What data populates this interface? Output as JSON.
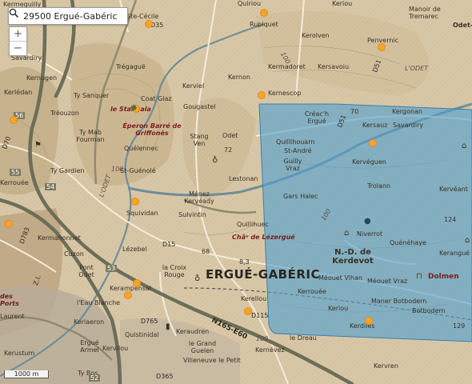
{
  "search": {
    "value": "29500 Ergué-Gabéric"
  },
  "zoom": {
    "in_label": "+",
    "out_label": "−"
  },
  "scale": {
    "label": "1000 m"
  },
  "places": [
    {
      "id": "kermeguilly",
      "text": "Kermeguilly"
    },
    {
      "id": "ste-cecile",
      "text": "Ste-Cécile"
    },
    {
      "id": "d35",
      "text": "D35"
    },
    {
      "id": "quirioux",
      "text": "Quiriou"
    },
    {
      "id": "keriou-top",
      "text": "Keriou"
    },
    {
      "id": "manoir-tremarec",
      "text": "Manoir de Tremarec"
    },
    {
      "id": "odet-top",
      "text": "Odet-"
    },
    {
      "id": "rupiquet",
      "text": "Rupiquet"
    },
    {
      "id": "kerolven",
      "text": "Kerolven"
    },
    {
      "id": "penvernic",
      "text": "Penvernic"
    },
    {
      "id": "savardiry-left",
      "text": "Savardiry"
    },
    {
      "id": "tregague",
      "text": "Trégaguë"
    },
    {
      "id": "kermadoret",
      "text": "Kermadoret"
    },
    {
      "id": "kersavoiu",
      "text": "Kersavoiu"
    },
    {
      "id": "d51-top",
      "text": "D51"
    },
    {
      "id": "lodet-top",
      "text": "L'ODET"
    },
    {
      "id": "kernugen",
      "text": "Kernugen"
    },
    {
      "id": "kerledan",
      "text": "Kerlédan"
    },
    {
      "id": "ty-sanquer",
      "text": "Ty Sanquer"
    },
    {
      "id": "kerviel",
      "text": "Kerviel"
    },
    {
      "id": "kernon",
      "text": "Kernon"
    },
    {
      "id": "kernescop",
      "text": "Kernescop"
    },
    {
      "id": "coat-glaz",
      "text": "Coat Glaz"
    },
    {
      "id": "le-stangala",
      "text": "le Stangala"
    },
    {
      "id": "gougastel",
      "text": "Gougastel"
    },
    {
      "id": "kergonan",
      "text": "Kergonan"
    },
    {
      "id": "treouzon",
      "text": "Tréouzon"
    },
    {
      "id": "creach-ergue",
      "text": "Créac'h Ergué"
    },
    {
      "id": "ty-mab-fourman",
      "text": "Ty Mab Fourman"
    },
    {
      "id": "eperon",
      "text": "Éperon Barré de Griffonès"
    },
    {
      "id": "odet-mid",
      "text": "Odet"
    },
    {
      "id": "kersauz",
      "text": "Kersauz"
    },
    {
      "id": "savardiry-right",
      "text": "Savardiry"
    },
    {
      "id": "quelennec",
      "text": "Quélennec"
    },
    {
      "id": "stang-ven",
      "text": "Stang Ven"
    },
    {
      "id": "quillihouarn",
      "text": "Quillihouarn"
    },
    {
      "id": "st-andre",
      "text": "St-André"
    },
    {
      "id": "guilly-vraz",
      "text": "Guilly Vraz"
    },
    {
      "id": "kerveguen",
      "text": "Kervéguen"
    },
    {
      "id": "ty-gardien",
      "text": "Ty Gardien"
    },
    {
      "id": "st-guenole",
      "text": "St-Guénolé"
    },
    {
      "id": "lestonan",
      "text": "Lestonan"
    },
    {
      "id": "trolann",
      "text": "Trolann"
    },
    {
      "id": "kerveant",
      "text": "Kervéant"
    },
    {
      "id": "kerrouee",
      "text": "Kerrouée"
    },
    {
      "id": "lodet-mid",
      "text": "L'ODET"
    },
    {
      "id": "menez-kerveady",
      "text": "Ménez Kervéady"
    },
    {
      "id": "gars-halec",
      "text": "Gars Halec"
    },
    {
      "id": "squividan",
      "text": "Squividan"
    },
    {
      "id": "sulvintin",
      "text": "Sulvintin"
    },
    {
      "id": "quillihuec",
      "text": "Quillihuec"
    },
    {
      "id": "kermahonnet",
      "text": "Kermahonnet"
    },
    {
      "id": "chateau-lezergue",
      "text": "Châᵘ de Lézergué"
    },
    {
      "id": "niverrot",
      "text": "Niverrot"
    },
    {
      "id": "quenehaye",
      "text": "Quénéhaye"
    },
    {
      "id": "kerangue",
      "text": "Kerangué"
    },
    {
      "id": "cuzon",
      "text": "Cuzon"
    },
    {
      "id": "lezebel",
      "text": "Lézebel"
    },
    {
      "id": "nd-kerdevot",
      "text": "N.-D. de Kerdevot"
    },
    {
      "id": "pont-odet",
      "text": "Pont Odet"
    },
    {
      "id": "la-croix-rouge",
      "text": "la Croix Rouge"
    },
    {
      "id": "ergue-gaberic",
      "text": "ERGUÉ-GABÉRIC"
    },
    {
      "id": "dolmen",
      "text": "Dolmen"
    },
    {
      "id": "meouet-vihan",
      "text": "Méouet Vihan"
    },
    {
      "id": "meouet-vraz",
      "text": "Méouet Vraz"
    },
    {
      "id": "za",
      "text": "Z.I."
    },
    {
      "id": "kerampensal",
      "text": "Kerampensal"
    },
    {
      "id": "kerrouee2",
      "text": "Kerrouée"
    },
    {
      "id": "des-ports",
      "text": "des Ports"
    },
    {
      "id": "eau-blanche",
      "text": "l'Eau Blanche"
    },
    {
      "id": "kerellou",
      "text": "Kerellou"
    },
    {
      "id": "keriou-bot",
      "text": "Keriou"
    },
    {
      "id": "maner-botbodern",
      "text": "Maner Botbodern"
    },
    {
      "id": "botbodern",
      "text": "Botbodern"
    },
    {
      "id": "laurent",
      "text": "Laurent"
    },
    {
      "id": "kerlaeron",
      "text": "Kerlaeron"
    },
    {
      "id": "quistinidal",
      "text": "Quistinidal"
    },
    {
      "id": "keraudren",
      "text": "Keraudren"
    },
    {
      "id": "le-grand-guelen",
      "text": "le Grand Guelen"
    },
    {
      "id": "kerdilès",
      "text": "Kerdilès"
    },
    {
      "id": "le-dreau",
      "text": "le Dreau"
    },
    {
      "id": "kerustum",
      "text": "Kerustum"
    },
    {
      "id": "ergue-armel",
      "text": "Ergué Armel"
    },
    {
      "id": "kervilou",
      "text": "Kervilou"
    },
    {
      "id": "villeneuve",
      "text": "Villeneuve le Petit"
    },
    {
      "id": "kernevez",
      "text": "Kernévez"
    },
    {
      "id": "ty-bos",
      "text": "Ty Bos"
    },
    {
      "id": "kervren",
      "text": "Kervren"
    }
  ],
  "roads": [
    {
      "id": "d15",
      "text": "D15"
    },
    {
      "id": "d70",
      "text": "D70"
    },
    {
      "id": "d783",
      "text": "D783"
    },
    {
      "id": "d765",
      "text": "D765"
    },
    {
      "id": "n165",
      "text": "N165-E60"
    },
    {
      "id": "d115",
      "text": "D115"
    },
    {
      "id": "d365",
      "text": "D365"
    },
    {
      "id": "d51",
      "text": "D51"
    },
    {
      "id": "r53",
      "text": "53"
    },
    {
      "id": "r55",
      "text": "55"
    },
    {
      "id": "r56",
      "text": "56"
    },
    {
      "id": "r54",
      "text": "54"
    },
    {
      "id": "r52",
      "text": "52"
    }
  ],
  "heights": [
    {
      "id": "h72",
      "text": "72"
    },
    {
      "id": "h68",
      "text": "68"
    },
    {
      "id": "h83",
      "text": "8,3"
    },
    {
      "id": "h124",
      "text": "124"
    },
    {
      "id": "h129",
      "text": "129"
    },
    {
      "id": "h70",
      "text": "70"
    },
    {
      "id": "h100a",
      "text": "100"
    },
    {
      "id": "h100b",
      "text": "100"
    },
    {
      "id": "h100c",
      "text": "100"
    },
    {
      "id": "h100d",
      "text": "100"
    }
  ],
  "colors": {
    "land": "#d8c7a6",
    "relief_dark": "#b59f7b",
    "river": "#6e8e98",
    "road_main": "#6c6e58",
    "road_secondary": "#f4ecd8",
    "overlay": "#4f9fd1",
    "marker": "#f7a52a"
  }
}
